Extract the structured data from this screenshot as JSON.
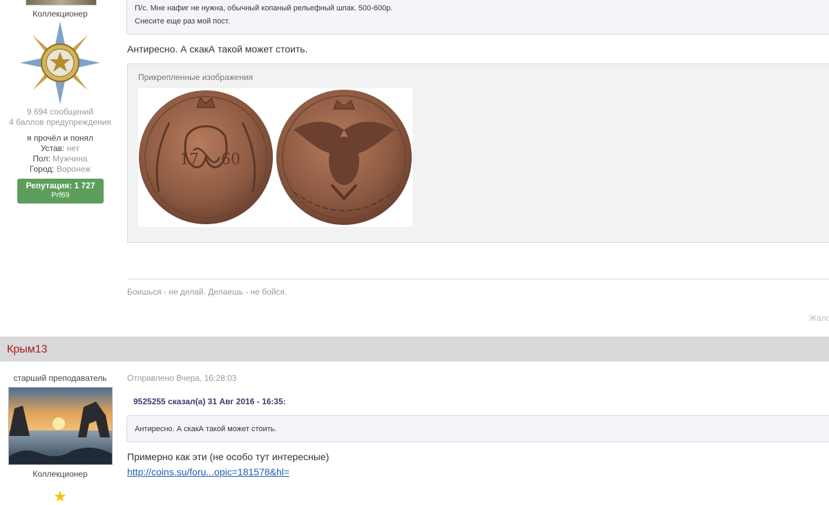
{
  "post1": {
    "user_group": "Коллекционер",
    "posts_count": "9 694 сообщений",
    "warning_points": "4 баллов предупреждения",
    "status_line": "я прочёл и понял",
    "field_charter_label": "Устав:",
    "field_charter_value": "нет",
    "field_gender_label": "Пол:",
    "field_gender_value": "Мужчина",
    "field_city_label": "Город:",
    "field_city_value": "Воронеж",
    "reputation_label": "Репутация: 1 727",
    "reputation_sub": "Prf69",
    "quote_line1": "П/с. Мне нафиг не нужна, обычный копаный рельефный шпак. 500-600р.",
    "quote_line2": "Снесите еще раз мой пост.",
    "body_text": "Антиресно. А скакА такой может стоить.",
    "attachments_title": "Прикрепленные изображения",
    "signature": "Боишься - не делай. Делаешь - не бойся.",
    "report_link": "Жало"
  },
  "post2": {
    "username": "Крым13",
    "user_title": "старший преподаватель",
    "user_group": "Коллекционер",
    "posted": "Отправлено Вчера, 16:28:03",
    "quote_citation": "9525255 сказал(а) 31 Авг 2016 - 16:35:",
    "quote_text": "Антиресно. А скакА такой может стоить.",
    "body_text": "Примерно как эти (не особо тут интересные)",
    "link_text": "http://coins.su/foru...opic=181578&hl="
  },
  "colors": {
    "reputation_bg": "#5d9e5d",
    "username": "#a31d1d",
    "link": "#1a5fb4",
    "star": "#f5c400"
  }
}
